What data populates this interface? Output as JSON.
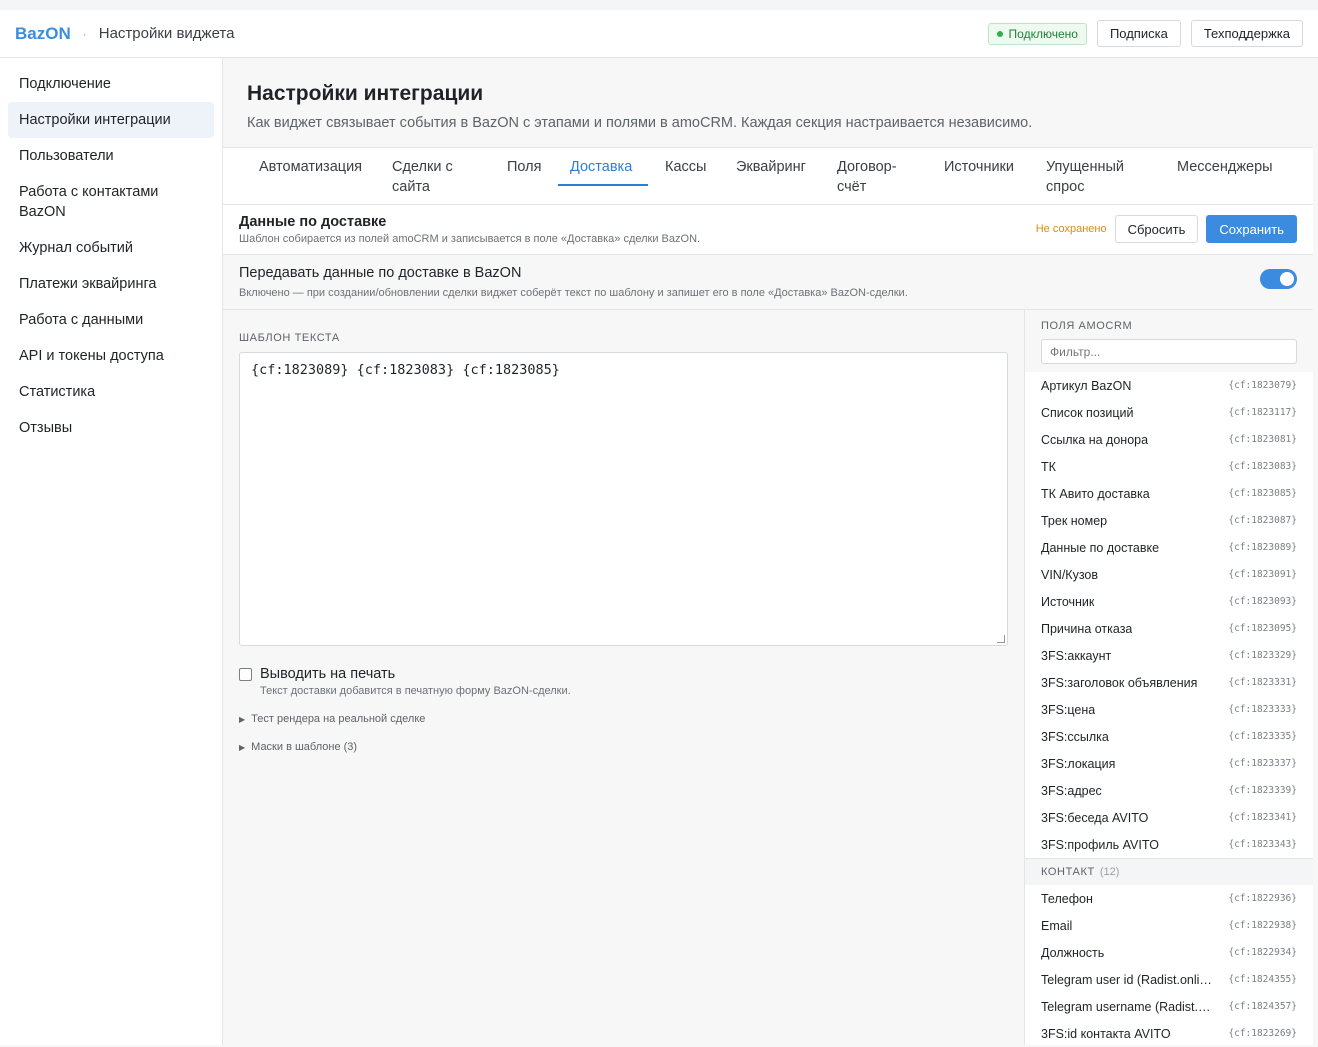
{
  "app": {
    "brand": "BazON",
    "page_name": "Настройки виджета"
  },
  "top": {
    "status": "Подключено",
    "subscription": "Подписка",
    "support": "Техподдержка"
  },
  "sidebar": {
    "items": [
      {
        "label": "Подключение"
      },
      {
        "label": "Настройки интеграции"
      },
      {
        "label": "Пользователи"
      },
      {
        "label": "Работа с контактами BazON"
      },
      {
        "label": "Журнал событий"
      },
      {
        "label": "Платежи эквайринга"
      },
      {
        "label": "Работа с данными"
      },
      {
        "label": "API и токены доступа"
      },
      {
        "label": "Статистика"
      },
      {
        "label": "Отзывы"
      }
    ]
  },
  "main": {
    "title": "Настройки интеграции",
    "subtitle": "Как виджет связывает события в BazON с этапами и полями в amoCRM. Каждая секция настраивается независимо.",
    "tabs": [
      {
        "label": "Автоматизация"
      },
      {
        "label": "Сделки с сайта"
      },
      {
        "label": "Поля"
      },
      {
        "label": "Доставка"
      },
      {
        "label": "Кассы"
      },
      {
        "label": "Эквайринг"
      },
      {
        "label": "Договор-счёт"
      },
      {
        "label": "Источники"
      },
      {
        "label": "Упущенный спрос"
      },
      {
        "label": "Мессенджеры"
      }
    ],
    "active_tab": "Доставка"
  },
  "section": {
    "title": "Данные по доставке",
    "subtitle": "Шаблон собирается из полей amoCRM и записывается в поле «Доставка» сделки BazON.",
    "unsaved": "Не сохранено",
    "reset": "Сбросить",
    "save": "Сохранить"
  },
  "transfer": {
    "title": "Передавать данные по доставке в BazON",
    "subtitle": "Включено — при создании/обновлении сделки виджет соберёт текст по шаблону и запишет его в поле «Доставка» BazON-сделки.",
    "enabled": true
  },
  "template": {
    "label": "ШАБЛОН ТЕКСТА",
    "value": "{cf:1823089} {cf:1823083} {cf:1823085}",
    "print_label": "Выводить на печать",
    "print_checked": false,
    "print_hint": "Текст доставки добавится в печатную форму BazON-сделки.",
    "details_test": "Тест рендера на реальной сделке",
    "details_masks": "Маски в шаблоне (3)"
  },
  "fields_panel": {
    "title": "ПОЛЯ AMOCRM",
    "filter_placeholder": "Фильтр...",
    "lead_fields": [
      {
        "name": "Артикул BazON",
        "code": "{cf:1823079}"
      },
      {
        "name": "Список позиций",
        "code": "{cf:1823117}"
      },
      {
        "name": "Ссылка на донора",
        "code": "{cf:1823081}"
      },
      {
        "name": "ТК",
        "code": "{cf:1823083}"
      },
      {
        "name": "ТК Авито доставка",
        "code": "{cf:1823085}"
      },
      {
        "name": "Трек номер",
        "code": "{cf:1823087}"
      },
      {
        "name": "Данные по доставке",
        "code": "{cf:1823089}"
      },
      {
        "name": "VIN/Кузов",
        "code": "{cf:1823091}"
      },
      {
        "name": "Источник",
        "code": "{cf:1823093}"
      },
      {
        "name": "Причина отказа",
        "code": "{cf:1823095}"
      },
      {
        "name": "3FS:аккаунт",
        "code": "{cf:1823329}"
      },
      {
        "name": "3FS:заголовок объявления",
        "code": "{cf:1823331}"
      },
      {
        "name": "3FS:цена",
        "code": "{cf:1823333}"
      },
      {
        "name": "3FS:ссылка",
        "code": "{cf:1823335}"
      },
      {
        "name": "3FS:локация",
        "code": "{cf:1823337}"
      },
      {
        "name": "3FS:адрес",
        "code": "{cf:1823339}"
      },
      {
        "name": "3FS:беседа AVITO",
        "code": "{cf:1823341}"
      },
      {
        "name": "3FS:профиль AVITO",
        "code": "{cf:1823343}"
      }
    ],
    "contact_group": {
      "title": "КОНТАКТ",
      "count": "(12)"
    },
    "contact_fields": [
      {
        "name": "Телефон",
        "code": "{cf:1822936}"
      },
      {
        "name": "Email",
        "code": "{cf:1822938}"
      },
      {
        "name": "Должность",
        "code": "{cf:1822934}"
      },
      {
        "name": "Telegram user id (Radist.online)",
        "code": "{cf:1824355}"
      },
      {
        "name": "Telegram username (Radist.online)",
        "code": "{cf:1824357}"
      },
      {
        "name": "3FS:id контакта AVITO",
        "code": "{cf:1823269}"
      }
    ]
  },
  "colors": {
    "accent": "#3b8be0",
    "status_ok": "#2fb14a",
    "warning": "#d88b1c"
  }
}
